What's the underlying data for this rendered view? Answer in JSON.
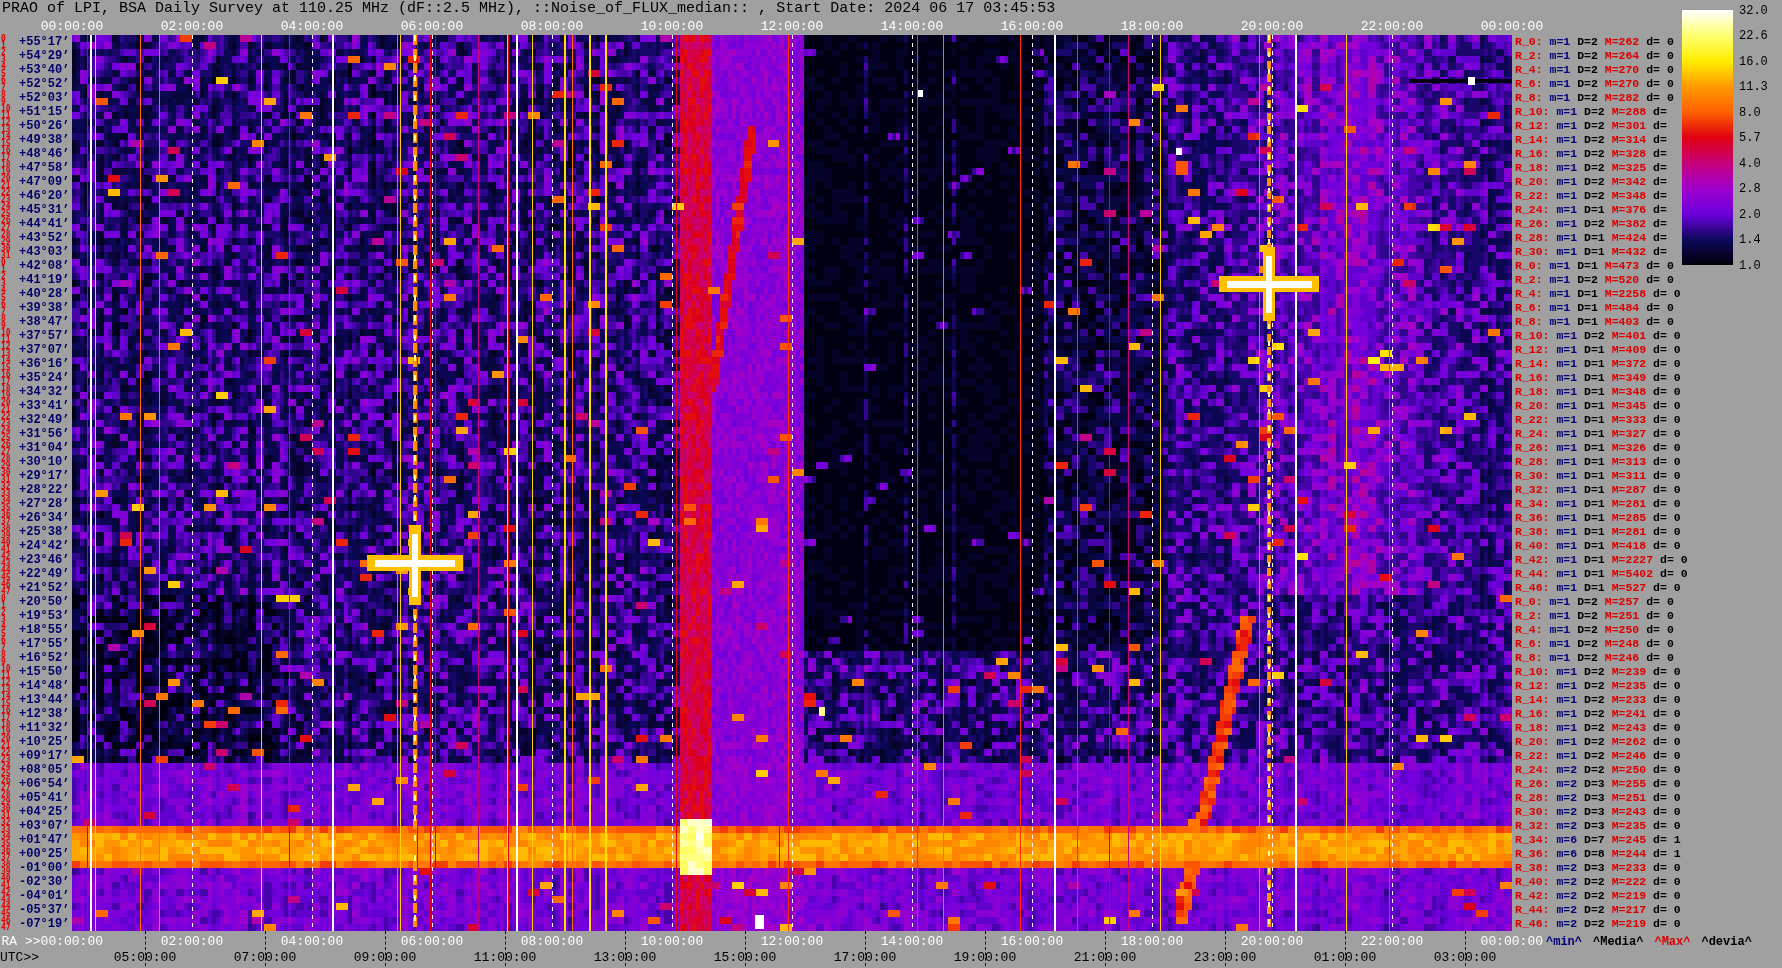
{
  "title": "PRAO of LPI, BSA Daily Survey at 110.25 MHz (dF::2.5 MHz), ::Noise_of_FLUX_median:: , Start Date: 2024 06 17 03:45:53",
  "top_axis": {
    "labels": [
      "00:00:00",
      "02:00:00",
      "04:00:00",
      "06:00:00",
      "08:00:00",
      "10:00:00",
      "12:00:00",
      "14:00:00",
      "16:00:00",
      "18:00:00",
      "20:00:00",
      "22:00:00",
      "00:00:00"
    ]
  },
  "declination_axis": [
    {
      "indices": [
        "0",
        "1"
      ],
      "label": "+55°17’"
    },
    {
      "indices": [
        "2",
        "3"
      ],
      "label": "+54°29’"
    },
    {
      "indices": [
        "4",
        "5"
      ],
      "label": "+53°40’"
    },
    {
      "indices": [
        "6",
        "7"
      ],
      "label": "+52°52’"
    },
    {
      "indices": [
        "8",
        "9"
      ],
      "label": "+52°03’"
    },
    {
      "indices": [
        "10",
        "11"
      ],
      "label": "+51°15’"
    },
    {
      "indices": [
        "12",
        "13"
      ],
      "label": "+50°26’"
    },
    {
      "indices": [
        "14",
        "15"
      ],
      "label": "+49°38’"
    },
    {
      "indices": [
        "16",
        "17"
      ],
      "label": "+48°46’"
    },
    {
      "indices": [
        "18",
        "19"
      ],
      "label": "+47°58’"
    },
    {
      "indices": [
        "20",
        "21"
      ],
      "label": "+47°09’"
    },
    {
      "indices": [
        "22",
        "23"
      ],
      "label": "+46°20’"
    },
    {
      "indices": [
        "24",
        "25"
      ],
      "label": "+45°31’"
    },
    {
      "indices": [
        "26",
        "27"
      ],
      "label": "+44°41’"
    },
    {
      "indices": [
        "28",
        "29"
      ],
      "label": "+43°52’"
    },
    {
      "indices": [
        "30",
        "31"
      ],
      "label": "+43°03’"
    },
    {
      "indices": [
        "0",
        "1"
      ],
      "label": "+42°08’"
    },
    {
      "indices": [
        "2",
        "3"
      ],
      "label": "+41°19’"
    },
    {
      "indices": [
        "4",
        "5"
      ],
      "label": "+40°28’"
    },
    {
      "indices": [
        "6",
        "7"
      ],
      "label": "+39°38’"
    },
    {
      "indices": [
        "8",
        "9"
      ],
      "label": "+38°47’"
    },
    {
      "indices": [
        "10",
        "11"
      ],
      "label": "+37°57’"
    },
    {
      "indices": [
        "12",
        "13"
      ],
      "label": "+37°07’"
    },
    {
      "indices": [
        "14",
        "15"
      ],
      "label": "+36°16’"
    },
    {
      "indices": [
        "16",
        "17"
      ],
      "label": "+35°24’"
    },
    {
      "indices": [
        "18",
        "19"
      ],
      "label": "+34°32’"
    },
    {
      "indices": [
        "20",
        "21"
      ],
      "label": "+33°41’"
    },
    {
      "indices": [
        "22",
        "23"
      ],
      "label": "+32°49’"
    },
    {
      "indices": [
        "24",
        "25"
      ],
      "label": "+31°56’"
    },
    {
      "indices": [
        "26",
        "27"
      ],
      "label": "+31°04’"
    },
    {
      "indices": [
        "28",
        "29"
      ],
      "label": "+30°10’"
    },
    {
      "indices": [
        "30",
        "31"
      ],
      "label": "+29°17’"
    },
    {
      "indices": [
        "32",
        "33"
      ],
      "label": "+28°22’"
    },
    {
      "indices": [
        "34",
        "35"
      ],
      "label": "+27°28’"
    },
    {
      "indices": [
        "36",
        "37"
      ],
      "label": "+26°34’"
    },
    {
      "indices": [
        "38",
        "39"
      ],
      "label": "+25°38’"
    },
    {
      "indices": [
        "40",
        "41"
      ],
      "label": "+24°42’"
    },
    {
      "indices": [
        "42",
        "43"
      ],
      "label": "+23°46’"
    },
    {
      "indices": [
        "44",
        "45"
      ],
      "label": "+22°49’"
    },
    {
      "indices": [
        "46",
        "47"
      ],
      "label": "+21°52’"
    },
    {
      "indices": [
        "0",
        "1"
      ],
      "label": "+20°50’"
    },
    {
      "indices": [
        "2",
        "3"
      ],
      "label": "+19°53’"
    },
    {
      "indices": [
        "4",
        "5"
      ],
      "label": "+18°55’"
    },
    {
      "indices": [
        "6",
        "7"
      ],
      "label": "+17°55’"
    },
    {
      "indices": [
        "8",
        "9"
      ],
      "label": "+16°52’"
    },
    {
      "indices": [
        "10",
        "11"
      ],
      "label": "+15°50’"
    },
    {
      "indices": [
        "12",
        "13"
      ],
      "label": "+14°48’"
    },
    {
      "indices": [
        "14",
        "15"
      ],
      "label": "+13°44’"
    },
    {
      "indices": [
        "16",
        "17"
      ],
      "label": "+12°38’"
    },
    {
      "indices": [
        "18",
        "19"
      ],
      "label": "+11°32’"
    },
    {
      "indices": [
        "20",
        "21"
      ],
      "label": "+10°25’"
    },
    {
      "indices": [
        "22",
        "23"
      ],
      "label": "+09°17’"
    },
    {
      "indices": [
        "24",
        "25"
      ],
      "label": "+08°05’"
    },
    {
      "indices": [
        "26",
        "27"
      ],
      "label": "+06°54’"
    },
    {
      "indices": [
        "28",
        "29"
      ],
      "label": "+05°41’"
    },
    {
      "indices": [
        "30",
        "31"
      ],
      "label": "+04°25’"
    },
    {
      "indices": [
        "32",
        "33"
      ],
      "label": "+03°07’"
    },
    {
      "indices": [
        "34",
        "35"
      ],
      "label": "+01°47’"
    },
    {
      "indices": [
        "36",
        "37"
      ],
      "label": "+00°25’"
    },
    {
      "indices": [
        "38",
        "39"
      ],
      "label": "-01°00’"
    },
    {
      "indices": [
        "40",
        "41"
      ],
      "label": "-02°30’"
    },
    {
      "indices": [
        "42",
        "43"
      ],
      "label": "-04°01’"
    },
    {
      "indices": [
        "44",
        "45"
      ],
      "label": "-05°37’"
    },
    {
      "indices": [
        "46",
        "47"
      ],
      "label": "-07°19’"
    }
  ],
  "beam_stats": [
    {
      "beam": "R_0:",
      "min": "m=1",
      "median": "D=2",
      "max": "M=262",
      "deviation": "d= 0"
    },
    {
      "beam": "R_2:",
      "min": "m=1",
      "median": "D=2",
      "max": "M=264",
      "deviation": "d= 0"
    },
    {
      "beam": "R_4:",
      "min": "m=1",
      "median": "D=2",
      "max": "M=270",
      "deviation": "d= 0"
    },
    {
      "beam": "R_6:",
      "min": "m=1",
      "median": "D=2",
      "max": "M=270",
      "deviation": "d= 0"
    },
    {
      "beam": "R_8:",
      "min": "m=1",
      "median": "D=2",
      "max": "M=282",
      "deviation": "d= 0"
    },
    {
      "beam": "R_10:",
      "min": "m=1",
      "median": "D=2",
      "max": "M=288",
      "deviation": "d="
    },
    {
      "beam": "R_12:",
      "min": "m=1",
      "median": "D=2",
      "max": "M=301",
      "deviation": "d="
    },
    {
      "beam": "R_14:",
      "min": "m=1",
      "median": "D=2",
      "max": "M=314",
      "deviation": "d="
    },
    {
      "beam": "R_16:",
      "min": "m=1",
      "median": "D=2",
      "max": "M=328",
      "deviation": "d="
    },
    {
      "beam": "R_18:",
      "min": "m=1",
      "median": "D=2",
      "max": "M=325",
      "deviation": "d="
    },
    {
      "beam": "R_20:",
      "min": "m=1",
      "median": "D=2",
      "max": "M=342",
      "deviation": "d="
    },
    {
      "beam": "R_22:",
      "min": "m=1",
      "median": "D=2",
      "max": "M=348",
      "deviation": "d="
    },
    {
      "beam": "R_24:",
      "min": "m=1",
      "median": "D=1",
      "max": "M=376",
      "deviation": "d="
    },
    {
      "beam": "R_26:",
      "min": "m=1",
      "median": "D=2",
      "max": "M=382",
      "deviation": "d="
    },
    {
      "beam": "R_28:",
      "min": "m=1",
      "median": "D=1",
      "max": "M=424",
      "deviation": "d="
    },
    {
      "beam": "R_30:",
      "min": "m=1",
      "median": "D=1",
      "max": "M=432",
      "deviation": "d="
    },
    {
      "beam": "R_0:",
      "min": "m=1",
      "median": "D=1",
      "max": "M=473",
      "deviation": "d= 0"
    },
    {
      "beam": "R_2:",
      "min": "m=1",
      "median": "D=2",
      "max": "M=520",
      "deviation": "d= 0"
    },
    {
      "beam": "R_4:",
      "min": "m=1",
      "median": "D=1",
      "max": "M=2258",
      "deviation": "d= 0"
    },
    {
      "beam": "R_6:",
      "min": "m=1",
      "median": "D=1",
      "max": "M=484",
      "deviation": "d= 0"
    },
    {
      "beam": "R_8:",
      "min": "m=1",
      "median": "D=1",
      "max": "M=403",
      "deviation": "d= 0"
    },
    {
      "beam": "R_10:",
      "min": "m=1",
      "median": "D=2",
      "max": "M=401",
      "deviation": "d= 0"
    },
    {
      "beam": "R_12:",
      "min": "m=1",
      "median": "D=1",
      "max": "M=409",
      "deviation": "d= 0"
    },
    {
      "beam": "R_14:",
      "min": "m=1",
      "median": "D=1",
      "max": "M=372",
      "deviation": "d= 0"
    },
    {
      "beam": "R_16:",
      "min": "m=1",
      "median": "D=1",
      "max": "M=349",
      "deviation": "d= 0"
    },
    {
      "beam": "R_18:",
      "min": "m=1",
      "median": "D=1",
      "max": "M=348",
      "deviation": "d= 0"
    },
    {
      "beam": "R_20:",
      "min": "m=1",
      "median": "D=1",
      "max": "M=345",
      "deviation": "d= 0"
    },
    {
      "beam": "R_22:",
      "min": "m=1",
      "median": "D=1",
      "max": "M=333",
      "deviation": "d= 0"
    },
    {
      "beam": "R_24:",
      "min": "m=1",
      "median": "D=1",
      "max": "M=327",
      "deviation": "d= 0"
    },
    {
      "beam": "R_26:",
      "min": "m=1",
      "median": "D=1",
      "max": "M=326",
      "deviation": "d= 0"
    },
    {
      "beam": "R_28:",
      "min": "m=1",
      "median": "D=1",
      "max": "M=313",
      "deviation": "d= 0"
    },
    {
      "beam": "R_30:",
      "min": "m=1",
      "median": "D=1",
      "max": "M=311",
      "deviation": "d= 0"
    },
    {
      "beam": "R_32:",
      "min": "m=1",
      "median": "D=1",
      "max": "M=287",
      "deviation": "d= 0"
    },
    {
      "beam": "R_34:",
      "min": "m=1",
      "median": "D=1",
      "max": "M=281",
      "deviation": "d= 0"
    },
    {
      "beam": "R_36:",
      "min": "m=1",
      "median": "D=1",
      "max": "M=285",
      "deviation": "d= 0"
    },
    {
      "beam": "R_38:",
      "min": "m=1",
      "median": "D=1",
      "max": "M=281",
      "deviation": "d= 0"
    },
    {
      "beam": "R_40:",
      "min": "m=1",
      "median": "D=1",
      "max": "M=418",
      "deviation": "d= 0"
    },
    {
      "beam": "R_42:",
      "min": "m=1",
      "median": "D=1",
      "max": "M=2227",
      "deviation": "d= 0"
    },
    {
      "beam": "R_44:",
      "min": "m=1",
      "median": "D=1",
      "max": "M=5402",
      "deviation": "d= 0"
    },
    {
      "beam": "R_46:",
      "min": "m=1",
      "median": "D=1",
      "max": "M=527",
      "deviation": "d= 0"
    },
    {
      "beam": "R_0:",
      "min": "m=1",
      "median": "D=2",
      "max": "M=257",
      "deviation": "d= 0"
    },
    {
      "beam": "R_2:",
      "min": "m=1",
      "median": "D=2",
      "max": "M=251",
      "deviation": "d= 0"
    },
    {
      "beam": "R_4:",
      "min": "m=1",
      "median": "D=2",
      "max": "M=250",
      "deviation": "d= 0"
    },
    {
      "beam": "R_6:",
      "min": "m=1",
      "median": "D=2",
      "max": "M=248",
      "deviation": "d= 0"
    },
    {
      "beam": "R_8:",
      "min": "m=1",
      "median": "D=2",
      "max": "M=246",
      "deviation": "d= 0"
    },
    {
      "beam": "R_10:",
      "min": "m=1",
      "median": "D=2",
      "max": "M=239",
      "deviation": "d= 0"
    },
    {
      "beam": "R_12:",
      "min": "m=1",
      "median": "D=2",
      "max": "M=235",
      "deviation": "d= 0"
    },
    {
      "beam": "R_14:",
      "min": "m=1",
      "median": "D=2",
      "max": "M=233",
      "deviation": "d= 0"
    },
    {
      "beam": "R_16:",
      "min": "m=1",
      "median": "D=2",
      "max": "M=241",
      "deviation": "d= 0"
    },
    {
      "beam": "R_18:",
      "min": "m=1",
      "median": "D=2",
      "max": "M=243",
      "deviation": "d= 0"
    },
    {
      "beam": "R_20:",
      "min": "m=1",
      "median": "D=2",
      "max": "M=262",
      "deviation": "d= 0"
    },
    {
      "beam": "R_22:",
      "min": "m=1",
      "median": "D=2",
      "max": "M=246",
      "deviation": "d= 0"
    },
    {
      "beam": "R_24:",
      "min": "m=2",
      "median": "D=2",
      "max": "M=250",
      "deviation": "d= 0"
    },
    {
      "beam": "R_26:",
      "min": "m=2",
      "median": "D=3",
      "max": "M=255",
      "deviation": "d= 0"
    },
    {
      "beam": "R_28:",
      "min": "m=2",
      "median": "D=3",
      "max": "M=251",
      "deviation": "d= 0"
    },
    {
      "beam": "R_30:",
      "min": "m=2",
      "median": "D=3",
      "max": "M=243",
      "deviation": "d= 0"
    },
    {
      "beam": "R_32:",
      "min": "m=2",
      "median": "D=3",
      "max": "M=235",
      "deviation": "d= 0"
    },
    {
      "beam": "R_34:",
      "min": "m=6",
      "median": "D=7",
      "max": "M=245",
      "deviation": "d= 1"
    },
    {
      "beam": "R_36:",
      "min": "m=6",
      "median": "D=8",
      "max": "M=244",
      "deviation": "d= 1"
    },
    {
      "beam": "R_38:",
      "min": "m=2",
      "median": "D=3",
      "max": "M=233",
      "deviation": "d= 0"
    },
    {
      "beam": "R_40:",
      "min": "m=2",
      "median": "D=2",
      "max": "M=222",
      "deviation": "d= 0"
    },
    {
      "beam": "R_42:",
      "min": "m=2",
      "median": "D=2",
      "max": "M=219",
      "deviation": "d= 0"
    },
    {
      "beam": "R_44:",
      "min": "m=2",
      "median": "D=2",
      "max": "M=217",
      "deviation": "d= 0"
    },
    {
      "beam": "R_46:",
      "min": "m=2",
      "median": "D=2",
      "max": "M=219",
      "deviation": "d= 0"
    }
  ],
  "colorbar": {
    "ticks": [
      "32.0",
      "22.6",
      "16.0",
      "11.3",
      "8.0",
      "5.7",
      "4.0",
      "2.8",
      "2.0",
      "1.4",
      "1.0"
    ]
  },
  "ra_axis": {
    "title": "RA >>",
    "labels": [
      "00:00:00",
      "02:00:00",
      "04:00:00",
      "06:00:00",
      "08:00:00",
      "10:00:00",
      "12:00:00",
      "14:00:00",
      "16:00:00",
      "18:00:00",
      "20:00:00",
      "22:00:00",
      "00:00:00"
    ]
  },
  "legend": [
    {
      "kind": "min",
      "text": "^min^"
    },
    {
      "kind": "median",
      "text": "^Media^"
    },
    {
      "kind": "max",
      "text": "^Max^"
    },
    {
      "kind": "deviation",
      "text": "^devia^"
    }
  ],
  "utc_axis": {
    "title": "UTC>>",
    "labels": [
      "05:00:00",
      "07:00:00",
      "09:00:00",
      "11:00:00",
      "13:00:00",
      "15:00:00",
      "17:00:00",
      "19:00:00",
      "21:00:00",
      "23:00:00",
      "01:00:00",
      "03:00:00"
    ]
  }
}
